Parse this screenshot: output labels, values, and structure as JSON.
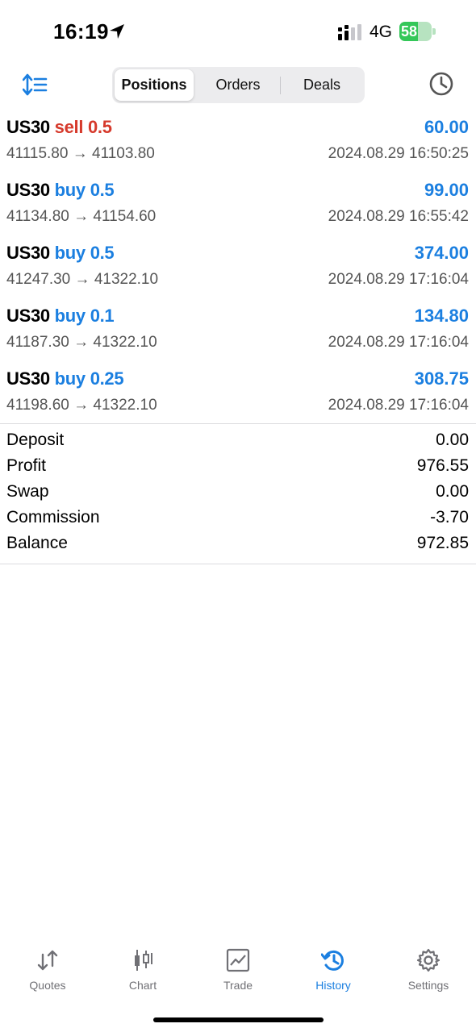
{
  "status_bar": {
    "time": "16:19",
    "network": "4G",
    "battery_level": "58",
    "battery_fraction": 0.58,
    "icons": [
      "location-arrow-icon",
      "cellular-signal-icon",
      "battery-charging-icon"
    ]
  },
  "toolbar": {
    "sort_icon": "sort-icon",
    "history_icon": "clock-icon",
    "tabs": [
      {
        "label": "Positions",
        "active": true
      },
      {
        "label": "Orders",
        "active": false
      },
      {
        "label": "Deals",
        "active": false
      }
    ]
  },
  "colors": {
    "accent": "#1b7fe0",
    "sell": "#d63a2c",
    "buy": "#1b7fe0",
    "battery": "#34c759"
  },
  "deals": [
    {
      "symbol": "US30",
      "direction": "sell",
      "volume": "0.5",
      "open": "41115.80",
      "close": "41103.80",
      "profit": "60.00",
      "time": "2024.08.29 16:50:25"
    },
    {
      "symbol": "US30",
      "direction": "buy",
      "volume": "0.5",
      "open": "41134.80",
      "close": "41154.60",
      "profit": "99.00",
      "time": "2024.08.29 16:55:42"
    },
    {
      "symbol": "US30",
      "direction": "buy",
      "volume": "0.5",
      "open": "41247.30",
      "close": "41322.10",
      "profit": "374.00",
      "time": "2024.08.29 17:16:04"
    },
    {
      "symbol": "US30",
      "direction": "buy",
      "volume": "0.1",
      "open": "41187.30",
      "close": "41322.10",
      "profit": "134.80",
      "time": "2024.08.29 17:16:04"
    },
    {
      "symbol": "US30",
      "direction": "buy",
      "volume": "0.25",
      "open": "41198.60",
      "close": "41322.10",
      "profit": "308.75",
      "time": "2024.08.29 17:16:04"
    }
  ],
  "summary": [
    {
      "label": "Deposit",
      "value": "0.00"
    },
    {
      "label": "Profit",
      "value": "976.55"
    },
    {
      "label": "Swap",
      "value": "0.00"
    },
    {
      "label": "Commission",
      "value": "-3.70"
    },
    {
      "label": "Balance",
      "value": "972.85"
    }
  ],
  "tabbar": [
    {
      "label": "Quotes",
      "icon": "quotes-arrows-icon",
      "active": false
    },
    {
      "label": "Chart",
      "icon": "candlestick-icon",
      "active": false
    },
    {
      "label": "Trade",
      "icon": "trade-chart-icon",
      "active": false
    },
    {
      "label": "History",
      "icon": "history-clock-icon",
      "active": true
    },
    {
      "label": "Settings",
      "icon": "gear-icon",
      "active": false
    }
  ]
}
